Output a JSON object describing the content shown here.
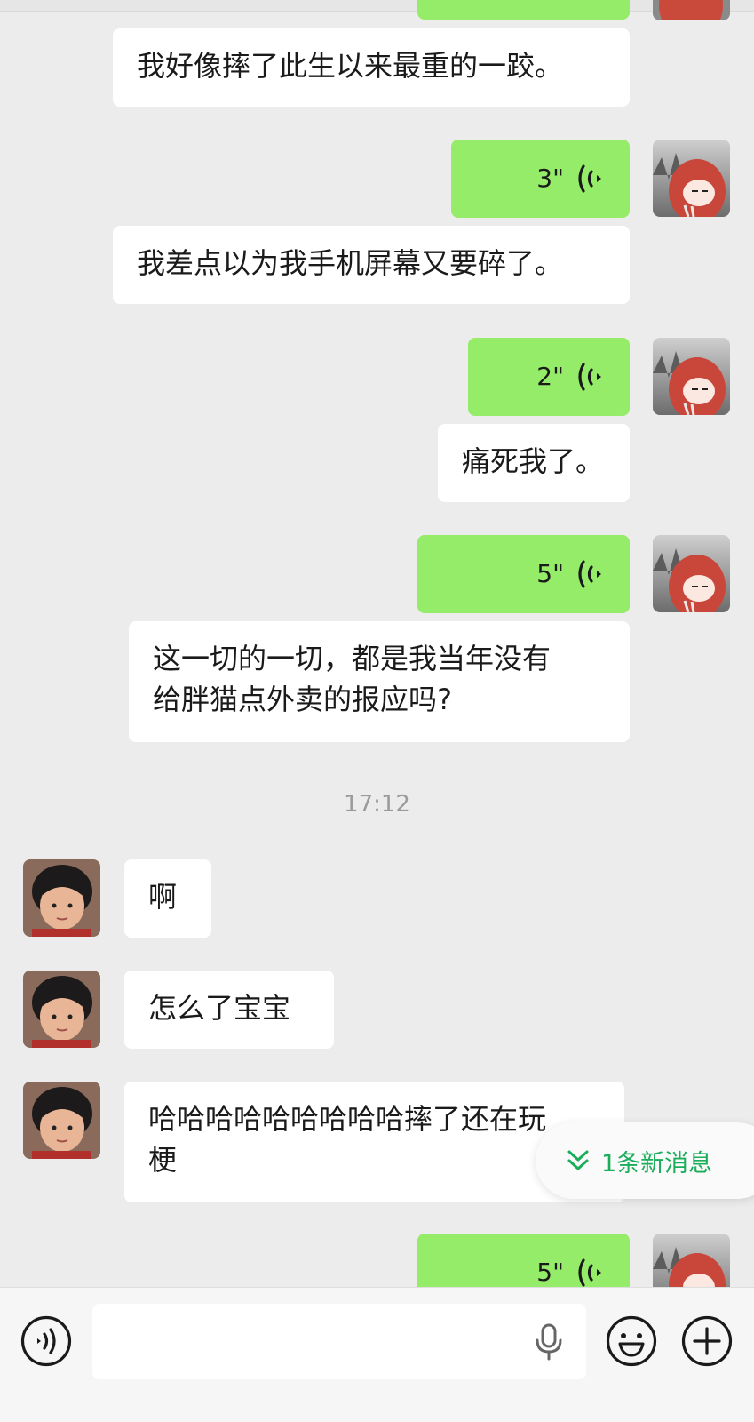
{
  "chat": {
    "messages": [
      {
        "type": "text",
        "side": "right",
        "text": "我好像摔了此生以来最重的一跤。"
      },
      {
        "type": "voice",
        "side": "right",
        "duration": "3\""
      },
      {
        "type": "text",
        "side": "right",
        "text": "我差点以为我手机屏幕又要碎了。"
      },
      {
        "type": "voice",
        "side": "right",
        "duration": "2\""
      },
      {
        "type": "text",
        "side": "right",
        "text": "痛死我了。"
      },
      {
        "type": "voice",
        "side": "right",
        "duration": "5\""
      },
      {
        "type": "text",
        "side": "right",
        "lines": [
          "这一切的一切，都是我当年没有",
          "给胖猫点外卖的报应吗?"
        ]
      },
      {
        "type": "text",
        "side": "left",
        "text": "啊"
      },
      {
        "type": "text",
        "side": "left",
        "text": "怎么了宝宝"
      },
      {
        "type": "text",
        "side": "left",
        "lines": [
          "哈哈哈哈哈哈哈哈哈摔了还在玩",
          "梗"
        ]
      },
      {
        "type": "voice",
        "side": "right",
        "duration": "5\""
      }
    ],
    "timestamp": "17:12"
  },
  "new_message_pill": {
    "label": "1条新消息"
  },
  "icons": {
    "voice_mode": "voice-mode-icon",
    "mic": "microphone-icon",
    "emoji": "emoji-icon",
    "plus": "plus-icon",
    "wave": "voice-wave-icon",
    "chevrons": "double-chevron-down-icon"
  },
  "colors": {
    "background": "#ececec",
    "bubble_sent": "#95ec69",
    "bubble_received": "#ffffff",
    "pill_text": "#1aad5a"
  }
}
